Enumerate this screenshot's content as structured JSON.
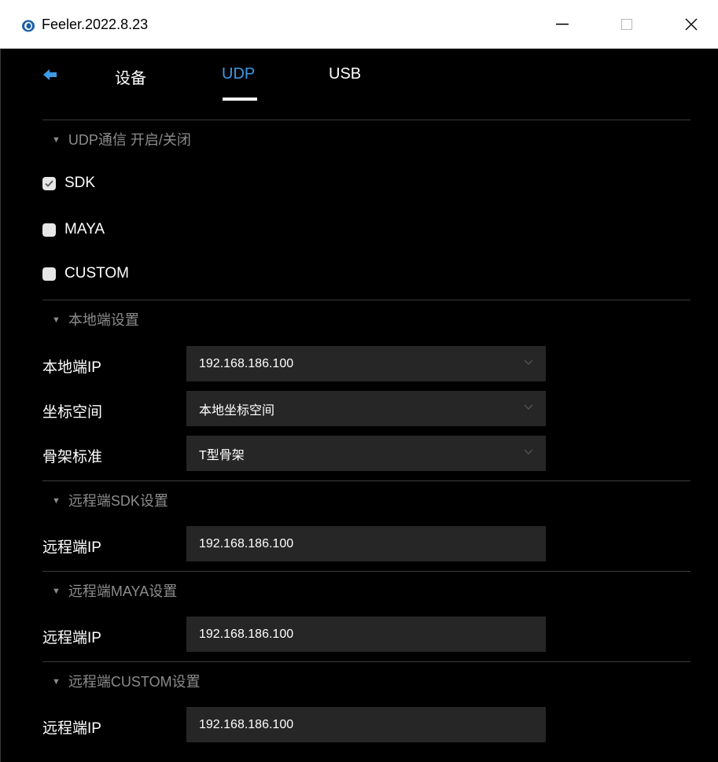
{
  "window": {
    "title": "Feeler.2022.8.23",
    "icon": "feeler-eye-icon"
  },
  "tabs": [
    {
      "label": "设备",
      "active": false
    },
    {
      "label": "UDP",
      "active": true
    },
    {
      "label": "USB",
      "active": false
    }
  ],
  "udp_section": {
    "header": "UDP通信 开启/关闭",
    "options": [
      {
        "label": "SDK",
        "checked": true
      },
      {
        "label": "MAYA",
        "checked": false
      },
      {
        "label": "CUSTOM",
        "checked": false
      }
    ]
  },
  "local_section": {
    "header": "本地端设置",
    "fields": [
      {
        "label": "本地端IP",
        "value": "192.168.186.100"
      },
      {
        "label": "坐标空间",
        "value": "本地坐标空间"
      },
      {
        "label": "骨架标准",
        "value": "T型骨架"
      }
    ]
  },
  "remote_sdk": {
    "header": "远程端SDK设置",
    "label": "远程端IP",
    "value": "192.168.186.100"
  },
  "remote_maya": {
    "header": "远程端MAYA设置",
    "label": "远程端IP",
    "value": "192.168.186.100"
  },
  "remote_custom": {
    "header": "远程端CUSTOM设置",
    "label": "远程端IP",
    "value": "192.168.186.100"
  },
  "colors": {
    "accent": "#3c9ae8",
    "background": "#000000",
    "field_bg": "#262626",
    "section_text": "#8c8c8c"
  }
}
